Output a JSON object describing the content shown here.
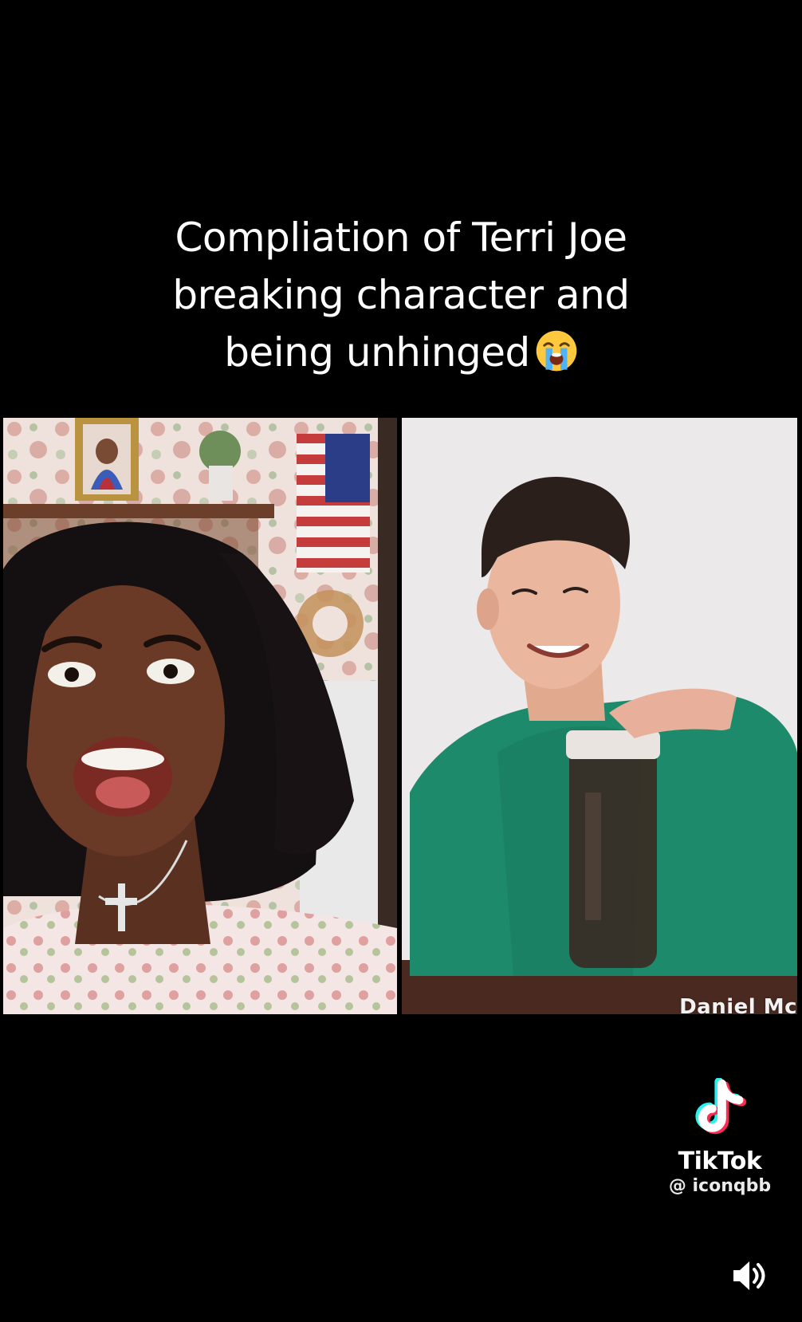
{
  "caption": {
    "lines": [
      "Compliation of Terri Joe",
      "breaking character and",
      "being unhinged"
    ],
    "emoji": "loudly-crying-face-emoji"
  },
  "video": {
    "right_participant_label": "Daniel Mc"
  },
  "watermark": {
    "brand": "TikTok",
    "handle": "@ iconqbb",
    "icon": "tiktok-logo-icon"
  },
  "controls": {
    "volume_icon": "volume-icon"
  },
  "colors": {
    "background": "#000000",
    "text": "#ffffff",
    "tiktok_cyan": "#25F4EE",
    "tiktok_red": "#FE2C55"
  }
}
